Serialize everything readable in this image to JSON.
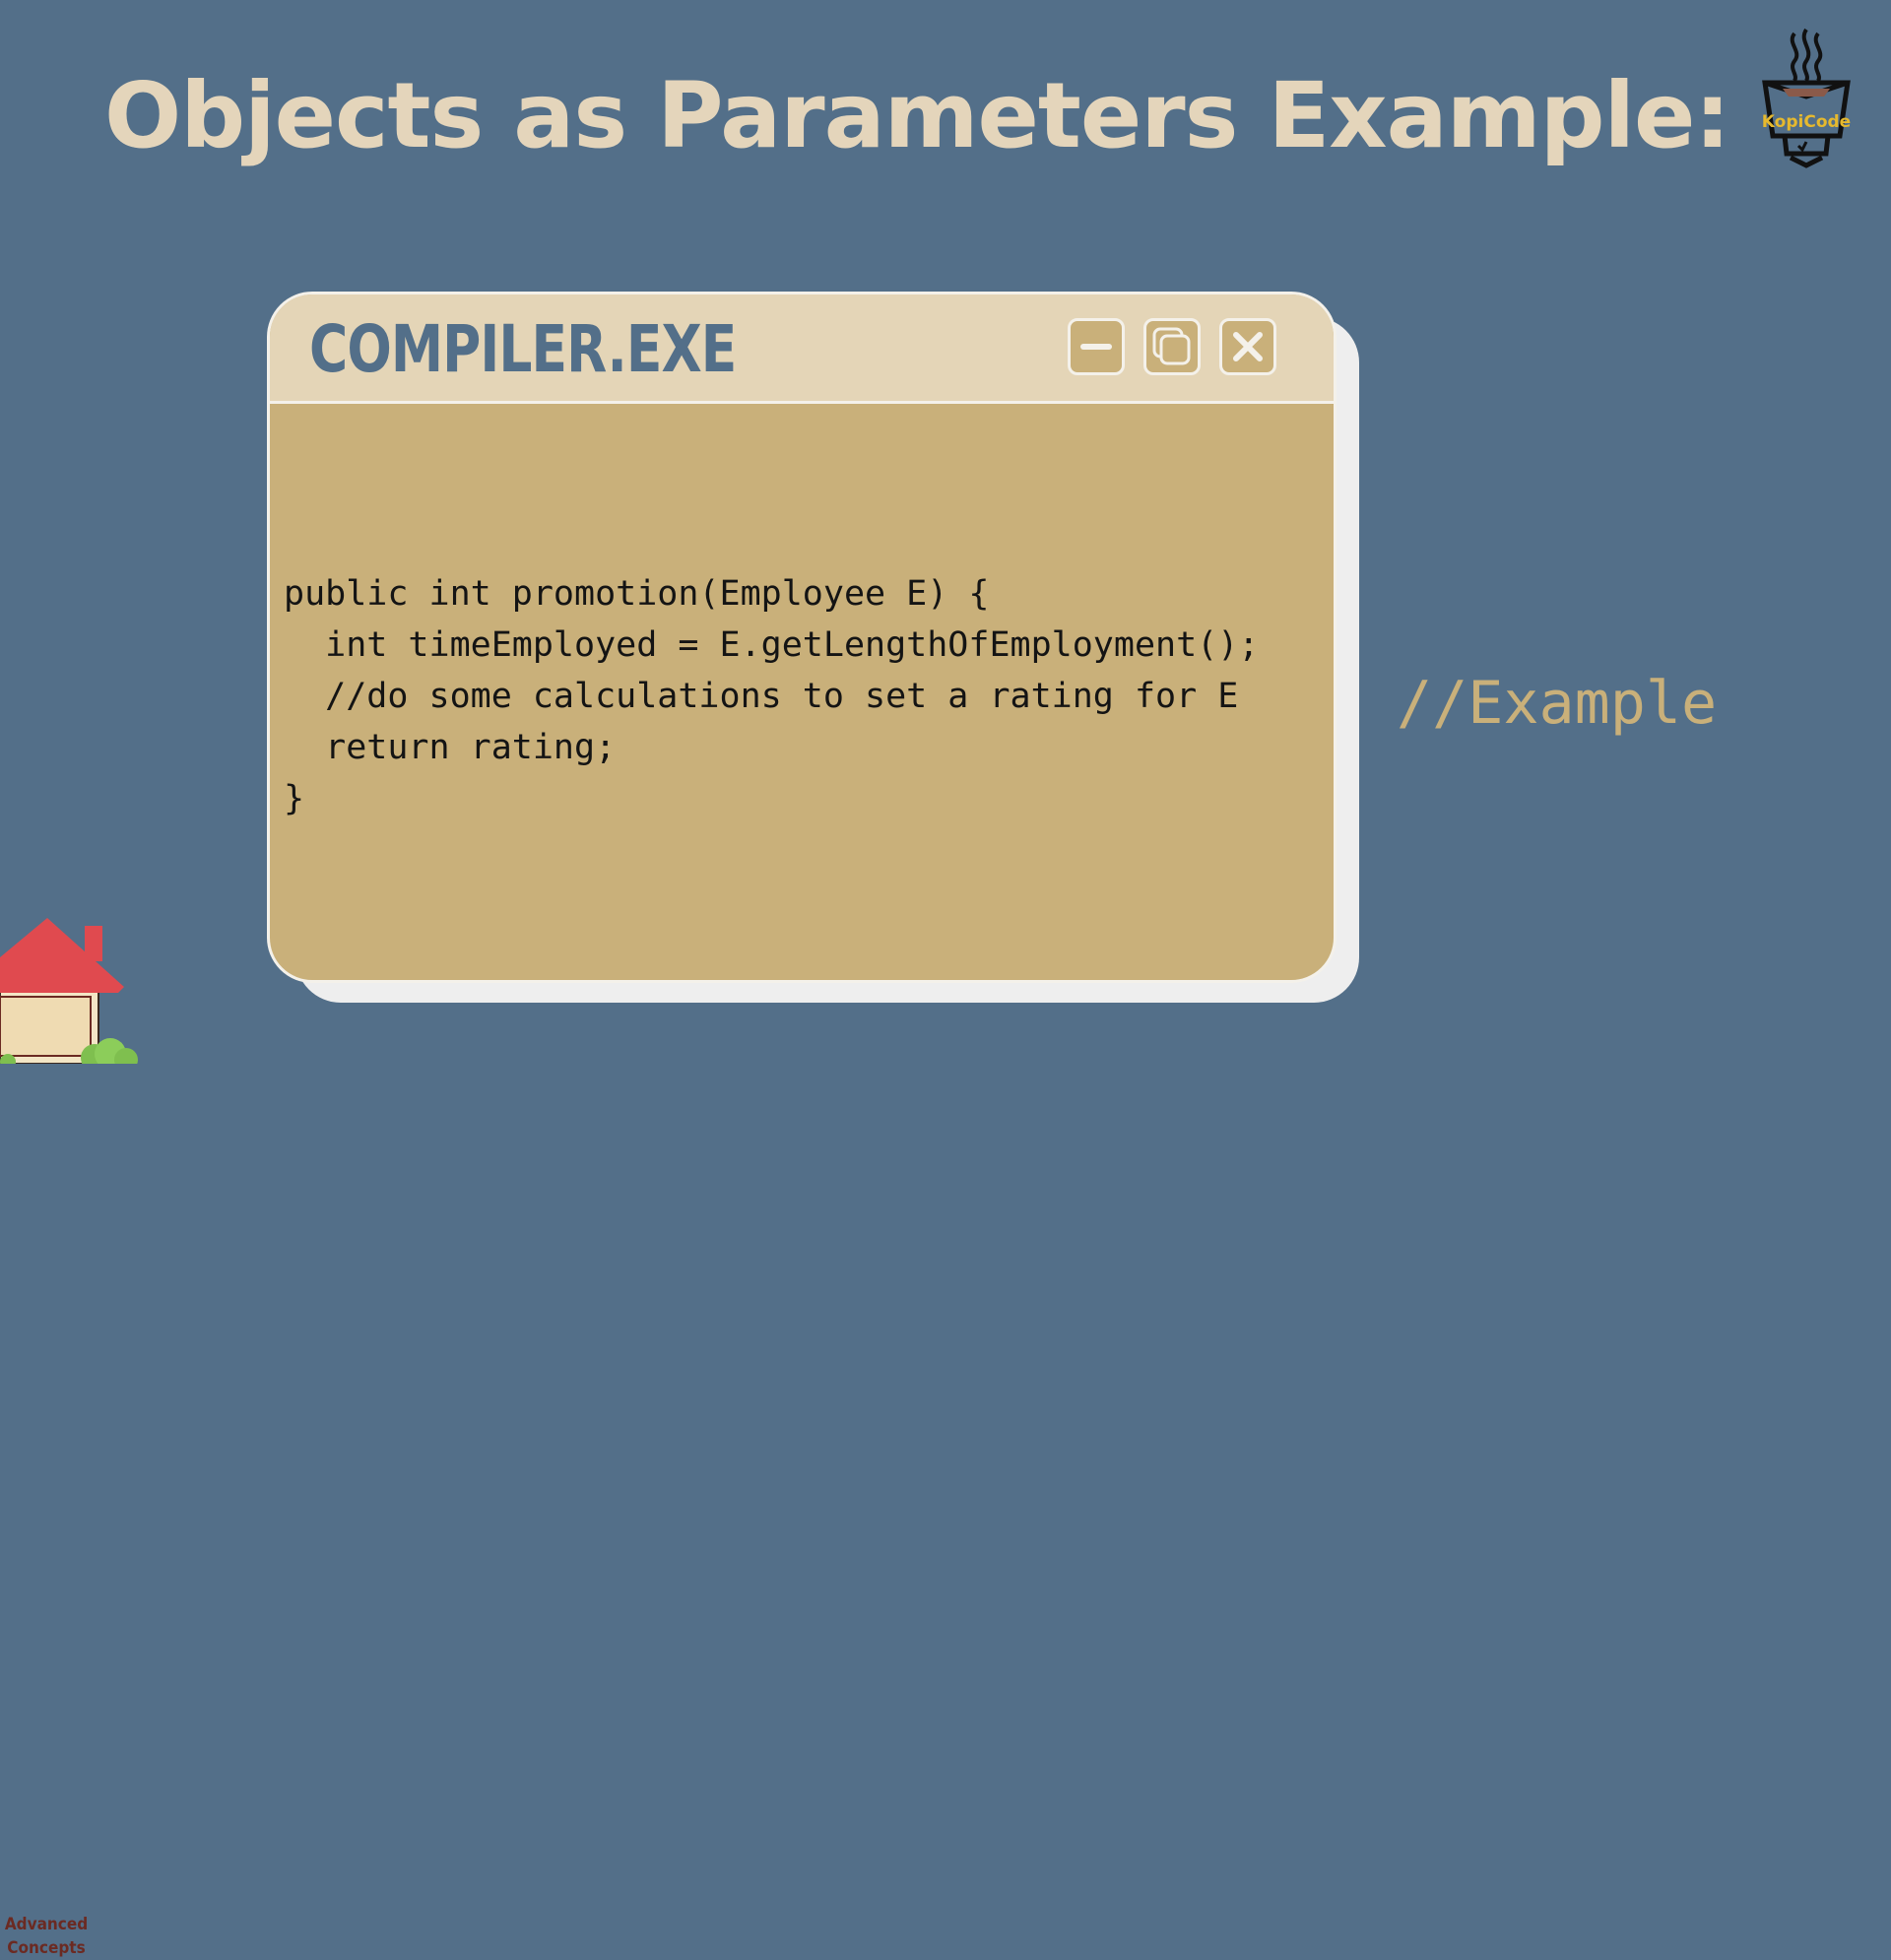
{
  "slide": {
    "title": "Objects as Parameters Example:"
  },
  "logo": {
    "text": "KopiCode",
    "icon": "coffee-cup-icon"
  },
  "window": {
    "title": "COMPILER.EXE",
    "buttons": {
      "minimize": "minimize-icon",
      "restore": "restore-icon",
      "close": "close-icon"
    }
  },
  "code": {
    "lines": [
      "public int promotion(Employee E) {",
      "  int timeEmployed = E.getLengthOfEmployment();",
      "  //do some calculations to set a rating for E",
      "  return rating;",
      "}"
    ]
  },
  "side_comment": "//Example",
  "home_badge": {
    "line1": "Advanced",
    "line2": "Concepts",
    "icon": "house-icon"
  },
  "colors": {
    "background": "#536f89",
    "title": "#e4d5bb",
    "window_body": "#c9b07a",
    "titlebar": "#e4d5b7",
    "house_roof": "#e04a4f"
  }
}
